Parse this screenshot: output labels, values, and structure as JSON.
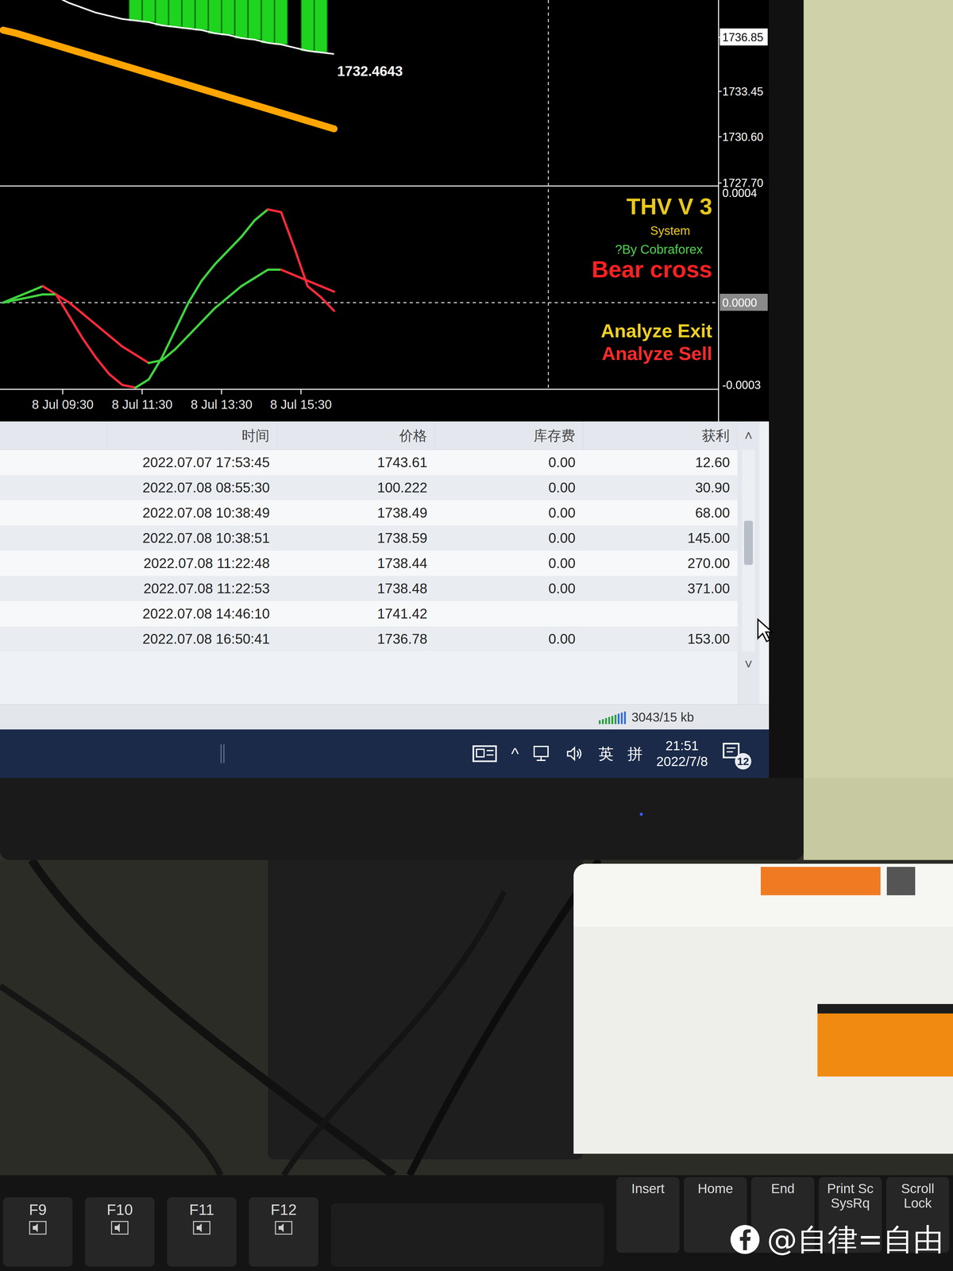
{
  "chart": {
    "price": {
      "axis": [
        {
          "label": "1736.85",
          "value": 1736.85,
          "highlighted": true
        },
        {
          "label": "1733.45",
          "value": 1733.45,
          "highlighted": false
        },
        {
          "label": "1730.60",
          "value": 1730.6,
          "highlighted": false
        },
        {
          "label": "1727.70",
          "value": 1727.7,
          "highlighted": false
        }
      ],
      "ma": [
        1737.3,
        1737.1,
        1736.85,
        1736.6,
        1736.35,
        1736.1,
        1735.85,
        1735.6,
        1735.35,
        1735.1,
        1734.85,
        1734.6,
        1734.35,
        1734.1,
        1733.85,
        1733.6,
        1733.35,
        1733.1,
        1732.85,
        1732.6,
        1732.35,
        1732.1,
        1731.85,
        1731.6,
        1731.35,
        1731.1
      ],
      "line": [
        1741.0,
        1740.6,
        1740.2,
        1739.8,
        1739.4,
        1739.0,
        1738.7,
        1738.4,
        1738.2,
        1738.0,
        1737.9,
        1737.8,
        1737.6,
        1737.5,
        1737.4,
        1737.3,
        1737.1,
        1737.0,
        1736.8,
        1736.7,
        1736.5,
        1736.4,
        1736.2,
        1736.0,
        1735.9,
        1735.8
      ],
      "bars": [
        {
          "index": 10,
          "high": 1740.0,
          "low": 1737.9
        },
        {
          "index": 11,
          "high": 1740.0,
          "low": 1737.8
        },
        {
          "index": 12,
          "high": 1740.0,
          "low": 1737.6
        },
        {
          "index": 13,
          "high": 1740.0,
          "low": 1737.5
        },
        {
          "index": 14,
          "high": 1740.0,
          "low": 1737.4
        },
        {
          "index": 15,
          "high": 1740.0,
          "low": 1737.3
        },
        {
          "index": 16,
          "high": 1740.0,
          "low": 1737.1
        },
        {
          "index": 17,
          "high": 1740.0,
          "low": 1737.0
        },
        {
          "index": 18,
          "high": 1740.0,
          "low": 1736.8
        },
        {
          "index": 19,
          "high": 1740.0,
          "low": 1736.7
        },
        {
          "index": 20,
          "high": 1740.0,
          "low": 1736.5
        },
        {
          "index": 21,
          "high": 1740.0,
          "low": 1736.4
        },
        {
          "index": 23,
          "high": 1740.0,
          "low": 1736.0
        },
        {
          "index": 24,
          "high": 1740.0,
          "low": 1735.9
        }
      ],
      "last_label": "1732.4643"
    },
    "indicator": {
      "axis": [
        {
          "label": "0.0004",
          "value": 0.0004,
          "highlighted": false
        },
        {
          "label": "0.0000",
          "value": 0,
          "highlighted": true
        },
        {
          "label": "-0.0003",
          "value": -0.0003,
          "highlighted": false
        }
      ],
      "fast": [
        0,
        2e-05,
        4e-05,
        6e-05,
        3e-05,
        -5e-05,
        -0.00013,
        -0.0002,
        -0.00026,
        -0.0003,
        -0.00031,
        -0.00028,
        -0.0002,
        -0.0001,
        0,
        8e-05,
        0.00014,
        0.00019,
        0.00024,
        0.0003,
        0.00034,
        0.00033,
        0.0002,
        6e-05,
        2e-05,
        -3e-05
      ],
      "slow": [
        0,
        1e-05,
        2e-05,
        3e-05,
        3e-05,
        0,
        -4e-05,
        -8e-05,
        -0.00012,
        -0.00016,
        -0.00019,
        -0.00022,
        -0.00021,
        -0.00017,
        -0.00012,
        -7e-05,
        -2e-05,
        2e-05,
        6e-05,
        9e-05,
        0.00012,
        0.00012,
        0.0001,
        8e-05,
        6e-05,
        4e-05
      ],
      "title": "THV V 3",
      "subtitle": "System",
      "credit": "?By Cobraforex",
      "signal": "Bear cross",
      "analysis": [
        {
          "text": "Analyze Exit",
          "color": "#f0d020"
        },
        {
          "text": "Analyze Sell",
          "color": "#ff2a2a"
        }
      ]
    },
    "time_axis": [
      "8 Jul 09:30",
      "8 Jul 11:30",
      "8 Jul 13:30",
      "8 Jul 15:30"
    ]
  },
  "table": {
    "columns": [
      "时间",
      "价格",
      "库存费",
      "获利"
    ],
    "rows": [
      [
        "2022.07.07 17:53:45",
        "1743.61",
        "0.00",
        "12.60"
      ],
      [
        "2022.07.08 08:55:30",
        "100.222",
        "0.00",
        "30.90"
      ],
      [
        "2022.07.08 10:38:49",
        "1738.49",
        "0.00",
        "68.00"
      ],
      [
        "2022.07.08 10:38:51",
        "1738.59",
        "0.00",
        "145.00"
      ],
      [
        "2022.07.08 11:22:48",
        "1738.44",
        "0.00",
        "270.00"
      ],
      [
        "2022.07.08 11:22:53",
        "1738.48",
        "0.00",
        "371.00"
      ],
      [
        "2022.07.08 14:46:10",
        "1741.42",
        "",
        ""
      ],
      [
        "2022.07.08 16:50:41",
        "1736.78",
        "0.00",
        "153.00"
      ]
    ],
    "scroll": {
      "level": 0.45,
      "up": "˄",
      "down": "˅"
    }
  },
  "status_bar": {
    "traffic": "3043/15 kb"
  },
  "taskbar": {
    "tray_arrow": "^",
    "ime": "英",
    "input_mode": "拼",
    "time": "21:51",
    "date": "2022/7/8",
    "notifications": "12"
  },
  "keyboard": [
    {
      "kind": "fkey",
      "lines": [
        "F9"
      ]
    },
    {
      "kind": "fkey",
      "lines": [
        "F10"
      ]
    },
    {
      "kind": "fkey",
      "lines": [
        "F11"
      ]
    },
    {
      "kind": "fkey",
      "lines": [
        "F12"
      ]
    },
    {
      "kind": "nav",
      "lines": [
        "Insert"
      ]
    },
    {
      "kind": "nav",
      "lines": [
        "Home"
      ]
    },
    {
      "kind": "nav",
      "lines": [
        "End"
      ]
    },
    {
      "kind": "nav",
      "lines": [
        "Print Sc",
        "SysRq"
      ]
    },
    {
      "kind": "nav",
      "lines": [
        "Scroll",
        "Lock"
      ]
    }
  ],
  "watermark": "@自律=自由"
}
